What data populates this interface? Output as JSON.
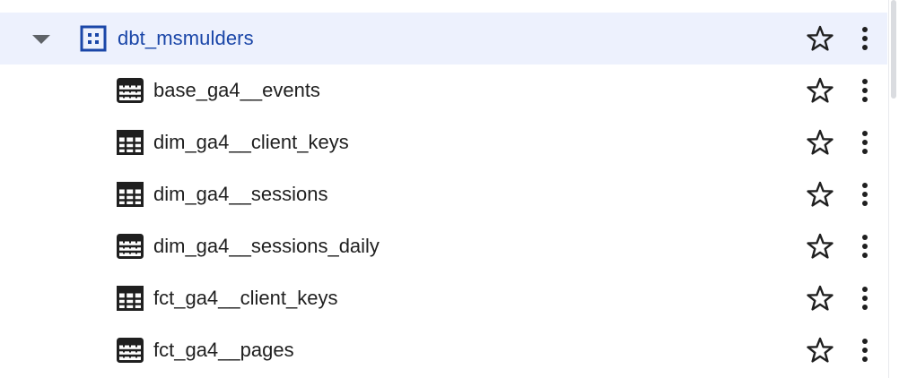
{
  "dataset": {
    "name": "dbt_msmulders",
    "expanded": true,
    "starred": false
  },
  "tables": [
    {
      "name": "base_ga4__events",
      "icon": "view-icon"
    },
    {
      "name": "dim_ga4__client_keys",
      "icon": "table-icon"
    },
    {
      "name": "dim_ga4__sessions",
      "icon": "table-icon"
    },
    {
      "name": "dim_ga4__sessions_daily",
      "icon": "view-icon"
    },
    {
      "name": "fct_ga4__client_keys",
      "icon": "table-icon"
    },
    {
      "name": "fct_ga4__pages",
      "icon": "view-icon"
    }
  ],
  "colors": {
    "dataset_highlight": "#edf1fd",
    "dataset_text": "#1a46a8",
    "text": "#1f1f1f"
  }
}
